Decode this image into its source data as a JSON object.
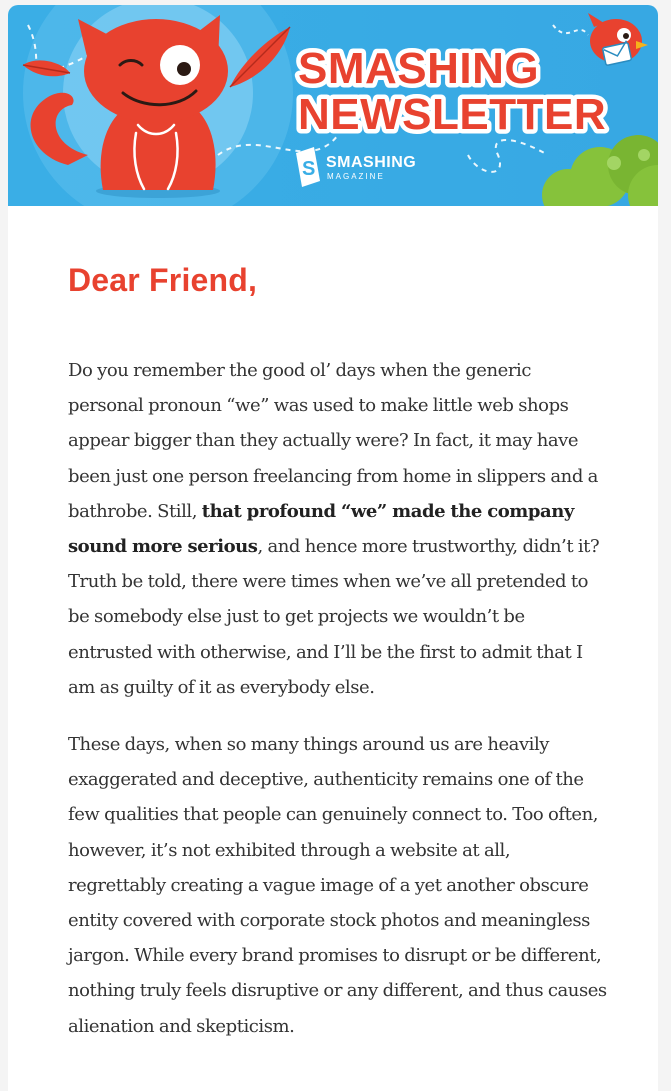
{
  "header": {
    "title_line1": "SMASHING",
    "title_line2": "NEWSLETTER",
    "logo_word": "SMASHING",
    "logo_sub": "MAGAZINE",
    "logo_mark": "S",
    "colors": {
      "sky": "#3fb1e6",
      "sky_light": "#8fd6f5",
      "brand_red": "#e8422f",
      "grass": "#86c23b"
    }
  },
  "letter": {
    "greeting": "Dear Friend,",
    "paragraph1": {
      "before": "Do you remember the good ol’ days when the generic personal pronoun “we” was used to make little web shops appear bigger than they actually were? In fact, it may have been just one person freelancing from home in slippers and a bathrobe. Still, ",
      "bold": "that profound “we” made the company sound more serious",
      "after": ", and hence more trustworthy, didn’t it? Truth be told, there were times when we’ve all pretended to be somebody else just to get projects we wouldn’t be entrusted with otherwise, and I’ll be the first to admit that I am as guilty of it as everybody else."
    },
    "paragraph2": "These days, when so many things around us are heavily exaggerated and deceptive, authenticity remains one of the few qualities that people can genuinely connect to. Too often, however, it’s not exhibited through a website at all, regrettably creating a vague image of a yet another obscure entity covered with corporate stock photos and meaningless jargon. While every brand promises to disrupt or be different, nothing truly feels disruptive or any different, and thus causes alienation and skepticism."
  }
}
